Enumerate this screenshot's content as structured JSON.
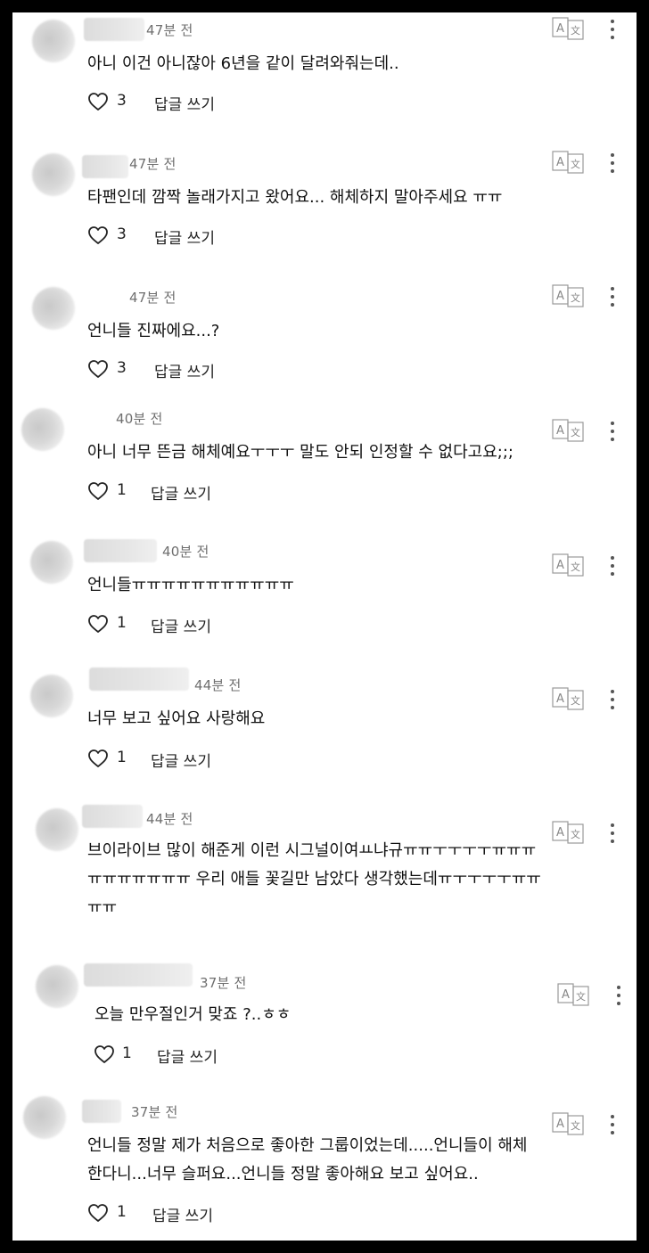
{
  "comments": [
    {
      "time": "47분 전",
      "text": [
        "아니 이건 아니잖아 6년을 같이 달려와줘는데.."
      ],
      "likes": "3",
      "reply_label": "답글 쓰기"
    },
    {
      "time": "47분 전",
      "text": [
        "타팬인데 깜짝 놀래가지고 왔어요... 해체하지 말아주세요 ㅠㅠ"
      ],
      "likes": "3",
      "reply_label": "답글 쓰기"
    },
    {
      "time": "47분 전",
      "text": [
        "언니들 진짜에요...?"
      ],
      "likes": "3",
      "reply_label": "답글 쓰기"
    },
    {
      "time": "40분 전",
      "text": [
        "아니 너무 뜬금 해체예요ㅜㅜㅜ 말도 안되 인정할 수 없다고요;;;"
      ],
      "likes": "1",
      "reply_label": "답글 쓰기"
    },
    {
      "time": "40분 전",
      "text": [
        "언니들ㅠㅠㅠㅠㅠㅠㅠㅠㅠㅠㅠ"
      ],
      "likes": "1",
      "reply_label": "답글 쓰기"
    },
    {
      "time": "44분 전",
      "text": [
        "너무 보고 싶어요 사랑해요"
      ],
      "likes": "1",
      "reply_label": "답글 쓰기"
    },
    {
      "time": "44분 전",
      "text": [
        "브이라이브 많이 해준게 이런 시그널이여ㅛ냐규ㅠㅠㅜㅜㅜㅜㅠㅠㅠ",
        "ㅠㅠㅠㅠㅠㅠㅠ 우리 애들 꽃길만 남았다 생각했는데ㅠㅜㅜㅜㅜㅠㅠ",
        "ㅠㅠ"
      ],
      "likes": "1",
      "reply_label": "답글 쓰기"
    },
    {
      "time": "37분 전",
      "text": [
        "오늘 만우절인거 맞죠 ?..ㅎㅎ"
      ],
      "likes": "1",
      "reply_label": "답글 쓰기"
    },
    {
      "time": "37분 전",
      "text": [
        "언니들 정말 제가 처음으로 좋아한 그룹이었는데.....언니들이 해체",
        "한다니...너무 슬퍼요...언니들 정말 좋아해요 보고 싶어요.."
      ],
      "likes": "1",
      "reply_label": "답글 쓰기"
    }
  ]
}
